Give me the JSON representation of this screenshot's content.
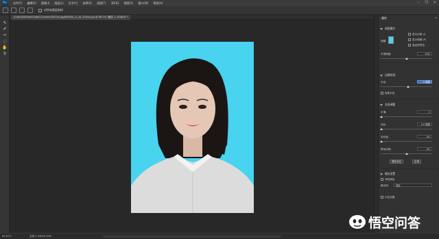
{
  "app": {
    "logo": "Ps"
  },
  "menu": {
    "items": [
      "文件(F)",
      "编辑(E)",
      "图像(I)",
      "图层(L)",
      "文字(Y)",
      "选择(S)",
      "滤镜(T)",
      "3D(D)",
      "视图(V)",
      "窗口(W)",
      "帮助(H)"
    ],
    "window_controls": [
      "–",
      "❐",
      "✕"
    ]
  },
  "options": {
    "check_label": "对所有图层取样"
  },
  "tools": [
    "brush-icon",
    "quick-selection-icon",
    "refine-edge-brush-icon",
    "lasso-icon",
    "hand-icon",
    "zoom-icon"
  ],
  "document": {
    "tab_label": "016d1859daef12a80121ae0c280135.jpg@900w_1l_2o_100sh.jpg @ 66.7% (图层 1, RGB/8) *",
    "zoom": "66.67%",
    "doc_size": "文档:2.93M/9.39M"
  },
  "properties": {
    "tab": "属性",
    "view_mode_heading": "视图模式",
    "view_label": "视图:",
    "show_edges": "显示边缘 (J)",
    "show_original": "显示原稿 (P)",
    "hq_preview": "高品质预览",
    "transparency_label": "不透明度:",
    "transparency_value": "50%",
    "edge_detection_heading": "边缘检测",
    "radius_label": "半径:",
    "radius_value": "0 像素",
    "smart_radius": "智能半径",
    "global_refine_heading": "全局调整",
    "smooth_label": "平滑:",
    "smooth_value": "0",
    "feather_label": "羽化:",
    "feather_value": "0.0 像素",
    "contrast_label": "对比度:",
    "contrast_value": "0%",
    "shift_edge_label": "移动边缘:",
    "shift_edge_value": "0%",
    "clear_selection": "清除选区",
    "invert": "反相",
    "output_heading": "输出设置",
    "decontaminate": "净化颜色",
    "output_to_label": "输出到:",
    "output_to_value": "选区",
    "remember_settings": "记住设置"
  },
  "watermark": {
    "text": "悟空问答"
  },
  "colors": {
    "backdrop": "#48d3ef",
    "accent": "#3d6fbf"
  }
}
